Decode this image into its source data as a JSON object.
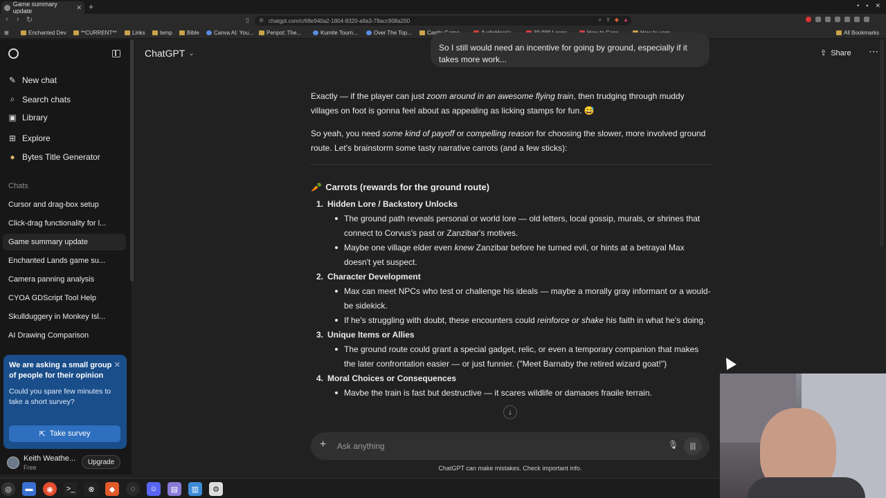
{
  "browser": {
    "tab_title": "Game summary update",
    "url": "chatgpt.com/c/68e940a2-1804-8320-a9a3-79acc908a200",
    "bookmarks": [
      "Enchanted Dev",
      "**CURRENT**",
      "Links",
      "temp",
      "Bible",
      "Canva AI: You...",
      "Penpot: The...",
      "Kumite Tourn...",
      "Over The Top...",
      "Castle Game...",
      "AudioHero's...",
      "30,000 Loops...",
      "How to Canc...",
      "How to upgr..."
    ],
    "all_bookmarks": "All Bookmarks"
  },
  "sidebar": {
    "nav": [
      {
        "label": "New chat",
        "icon": "edit-icon"
      },
      {
        "label": "Search chats",
        "icon": "search-icon"
      },
      {
        "label": "Library",
        "icon": "library-icon"
      },
      {
        "label": "Explore",
        "icon": "explore-icon"
      },
      {
        "label": "Bytes Title Generator",
        "icon": "gpt-icon"
      }
    ],
    "section": "Chats",
    "chats": [
      "Cursor and drag-box setup",
      "Click-drag functionality for l...",
      "Game summary update",
      "Enchanted Lands game su...",
      "Camera panning analysis",
      "CYOA GDScript Tool Help",
      "Skullduggery in Monkey Isl...",
      "AI Drawing Comparison"
    ],
    "active_chat": "Game summary update",
    "survey": {
      "title": "We are asking a small group of people for their opinion",
      "body": "Could you spare few minutes to take a short survey?",
      "button": "Take survey"
    },
    "user": {
      "name": "Keith Weathe...",
      "plan": "Free",
      "upgrade": "Upgrade"
    }
  },
  "header": {
    "model": "ChatGPT",
    "share": "Share"
  },
  "conversation": {
    "user_message": "So I still would need an incentive for going by ground, especially if it takes more work...",
    "para1_a": "Exactly — if the player can just ",
    "para1_em": "zoom around in an awesome flying train",
    "para1_b": ", then trudging through muddy villages on foot is gonna feel about as appealing as licking stamps for fun. 😅",
    "para2_a": "So yeah, you need ",
    "para2_em1": "some kind of payoff",
    "para2_mid": " or ",
    "para2_em2": "compelling reason",
    "para2_b": " for choosing the slower, more involved ground route. Let's brainstorm some tasty narrative carrots (and a few sticks):",
    "heading": "Carrots (rewards for the ground route)",
    "items": [
      {
        "num": "1.",
        "title": "Hidden Lore / Backstory Unlocks",
        "bullets": [
          {
            "a": "The ground path reveals personal or world lore — old letters, local gossip, murals, or shrines that connect to Corvus's past or Zanzibar's motives.",
            "em": "",
            "b": ""
          },
          {
            "a": "Maybe one village elder even ",
            "em": "knew",
            "b": " Zanzibar before he turned evil, or hints at a betrayal Max doesn't yet suspect."
          }
        ]
      },
      {
        "num": "2.",
        "title": "Character Development",
        "bullets": [
          {
            "a": "Max can meet NPCs who test or challenge his ideals — maybe a morally gray informant or a would-be sidekick.",
            "em": "",
            "b": ""
          },
          {
            "a": "If he's struggling with doubt, these encounters could ",
            "em": "reinforce or shake",
            "b": " his faith in what he's doing."
          }
        ]
      },
      {
        "num": "3.",
        "title": "Unique Items or Allies",
        "bullets": [
          {
            "a": "The ground route could grant a special gadget, relic, or even a temporary companion that makes the later confrontation easier — or just funnier. (\"Meet Barnaby the retired wizard goat!\")",
            "em": "",
            "b": ""
          }
        ]
      },
      {
        "num": "4.",
        "title": "Moral Choices or Consequences",
        "bullets": [
          {
            "a": "Maybe the train is fast but destructive — it scares wildlife or damages fragile terrain.",
            "em": "",
            "b": ""
          }
        ]
      }
    ]
  },
  "composer": {
    "placeholder": "Ask anything",
    "disclaimer": "ChatGPT can make mistakes. Check important info."
  }
}
